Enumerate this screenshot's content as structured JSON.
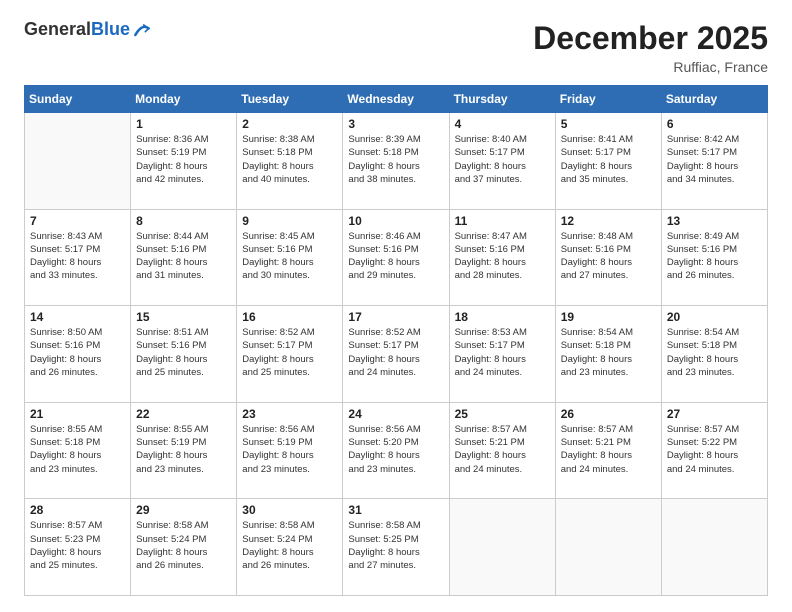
{
  "header": {
    "logo_general": "General",
    "logo_blue": "Blue",
    "month_title": "December 2025",
    "location": "Ruffiac, France"
  },
  "days_of_week": [
    "Sunday",
    "Monday",
    "Tuesday",
    "Wednesday",
    "Thursday",
    "Friday",
    "Saturday"
  ],
  "weeks": [
    [
      {
        "day": "",
        "info": ""
      },
      {
        "day": "1",
        "info": "Sunrise: 8:36 AM\nSunset: 5:19 PM\nDaylight: 8 hours\nand 42 minutes."
      },
      {
        "day": "2",
        "info": "Sunrise: 8:38 AM\nSunset: 5:18 PM\nDaylight: 8 hours\nand 40 minutes."
      },
      {
        "day": "3",
        "info": "Sunrise: 8:39 AM\nSunset: 5:18 PM\nDaylight: 8 hours\nand 38 minutes."
      },
      {
        "day": "4",
        "info": "Sunrise: 8:40 AM\nSunset: 5:17 PM\nDaylight: 8 hours\nand 37 minutes."
      },
      {
        "day": "5",
        "info": "Sunrise: 8:41 AM\nSunset: 5:17 PM\nDaylight: 8 hours\nand 35 minutes."
      },
      {
        "day": "6",
        "info": "Sunrise: 8:42 AM\nSunset: 5:17 PM\nDaylight: 8 hours\nand 34 minutes."
      }
    ],
    [
      {
        "day": "7",
        "info": "Sunrise: 8:43 AM\nSunset: 5:17 PM\nDaylight: 8 hours\nand 33 minutes."
      },
      {
        "day": "8",
        "info": "Sunrise: 8:44 AM\nSunset: 5:16 PM\nDaylight: 8 hours\nand 31 minutes."
      },
      {
        "day": "9",
        "info": "Sunrise: 8:45 AM\nSunset: 5:16 PM\nDaylight: 8 hours\nand 30 minutes."
      },
      {
        "day": "10",
        "info": "Sunrise: 8:46 AM\nSunset: 5:16 PM\nDaylight: 8 hours\nand 29 minutes."
      },
      {
        "day": "11",
        "info": "Sunrise: 8:47 AM\nSunset: 5:16 PM\nDaylight: 8 hours\nand 28 minutes."
      },
      {
        "day": "12",
        "info": "Sunrise: 8:48 AM\nSunset: 5:16 PM\nDaylight: 8 hours\nand 27 minutes."
      },
      {
        "day": "13",
        "info": "Sunrise: 8:49 AM\nSunset: 5:16 PM\nDaylight: 8 hours\nand 26 minutes."
      }
    ],
    [
      {
        "day": "14",
        "info": "Sunrise: 8:50 AM\nSunset: 5:16 PM\nDaylight: 8 hours\nand 26 minutes."
      },
      {
        "day": "15",
        "info": "Sunrise: 8:51 AM\nSunset: 5:16 PM\nDaylight: 8 hours\nand 25 minutes."
      },
      {
        "day": "16",
        "info": "Sunrise: 8:52 AM\nSunset: 5:17 PM\nDaylight: 8 hours\nand 25 minutes."
      },
      {
        "day": "17",
        "info": "Sunrise: 8:52 AM\nSunset: 5:17 PM\nDaylight: 8 hours\nand 24 minutes."
      },
      {
        "day": "18",
        "info": "Sunrise: 8:53 AM\nSunset: 5:17 PM\nDaylight: 8 hours\nand 24 minutes."
      },
      {
        "day": "19",
        "info": "Sunrise: 8:54 AM\nSunset: 5:18 PM\nDaylight: 8 hours\nand 23 minutes."
      },
      {
        "day": "20",
        "info": "Sunrise: 8:54 AM\nSunset: 5:18 PM\nDaylight: 8 hours\nand 23 minutes."
      }
    ],
    [
      {
        "day": "21",
        "info": "Sunrise: 8:55 AM\nSunset: 5:18 PM\nDaylight: 8 hours\nand 23 minutes."
      },
      {
        "day": "22",
        "info": "Sunrise: 8:55 AM\nSunset: 5:19 PM\nDaylight: 8 hours\nand 23 minutes."
      },
      {
        "day": "23",
        "info": "Sunrise: 8:56 AM\nSunset: 5:19 PM\nDaylight: 8 hours\nand 23 minutes."
      },
      {
        "day": "24",
        "info": "Sunrise: 8:56 AM\nSunset: 5:20 PM\nDaylight: 8 hours\nand 23 minutes."
      },
      {
        "day": "25",
        "info": "Sunrise: 8:57 AM\nSunset: 5:21 PM\nDaylight: 8 hours\nand 24 minutes."
      },
      {
        "day": "26",
        "info": "Sunrise: 8:57 AM\nSunset: 5:21 PM\nDaylight: 8 hours\nand 24 minutes."
      },
      {
        "day": "27",
        "info": "Sunrise: 8:57 AM\nSunset: 5:22 PM\nDaylight: 8 hours\nand 24 minutes."
      }
    ],
    [
      {
        "day": "28",
        "info": "Sunrise: 8:57 AM\nSunset: 5:23 PM\nDaylight: 8 hours\nand 25 minutes."
      },
      {
        "day": "29",
        "info": "Sunrise: 8:58 AM\nSunset: 5:24 PM\nDaylight: 8 hours\nand 26 minutes."
      },
      {
        "day": "30",
        "info": "Sunrise: 8:58 AM\nSunset: 5:24 PM\nDaylight: 8 hours\nand 26 minutes."
      },
      {
        "day": "31",
        "info": "Sunrise: 8:58 AM\nSunset: 5:25 PM\nDaylight: 8 hours\nand 27 minutes."
      },
      {
        "day": "",
        "info": ""
      },
      {
        "day": "",
        "info": ""
      },
      {
        "day": "",
        "info": ""
      }
    ]
  ]
}
